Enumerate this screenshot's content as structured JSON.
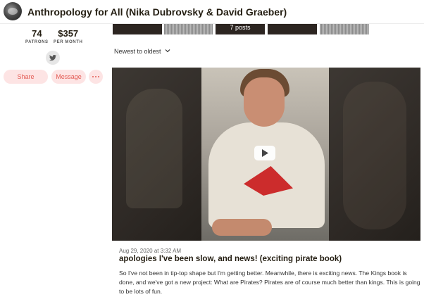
{
  "header": {
    "title": "Anthropology for All (Nika Dubrovsky & David Graeber)",
    "avatar_icon": "creator-avatar"
  },
  "stats": {
    "patrons_value": "74",
    "patrons_label": "PATRONS",
    "earnings_value": "$357",
    "earnings_label": "PER MONTH"
  },
  "social": {
    "twitter_icon": "twitter-icon"
  },
  "actions": {
    "share_label": "Share",
    "message_label": "Message",
    "more_icon": "more-dots-icon"
  },
  "thumbnails": {
    "collection_label": "7 posts"
  },
  "sort": {
    "label": "Newest to oldest",
    "icon": "chevron-down-icon"
  },
  "post": {
    "date": "Aug 29, 2020 at 3:32 AM",
    "title": "apologies I've been slow, and news! (exciting pirate book)",
    "body": "So I've not been in tip-top shape but I'm getting better. Meanwhile, there is exciting news. The Kings book is done, and we've got a new project: What are Pirates? Pirates are of course much better than kings. This is going to be lots of fun.",
    "play_icon": "play-icon"
  },
  "colors": {
    "accent": "#e35b54",
    "accent_bg": "#fde4e4",
    "text": "#241e12"
  }
}
